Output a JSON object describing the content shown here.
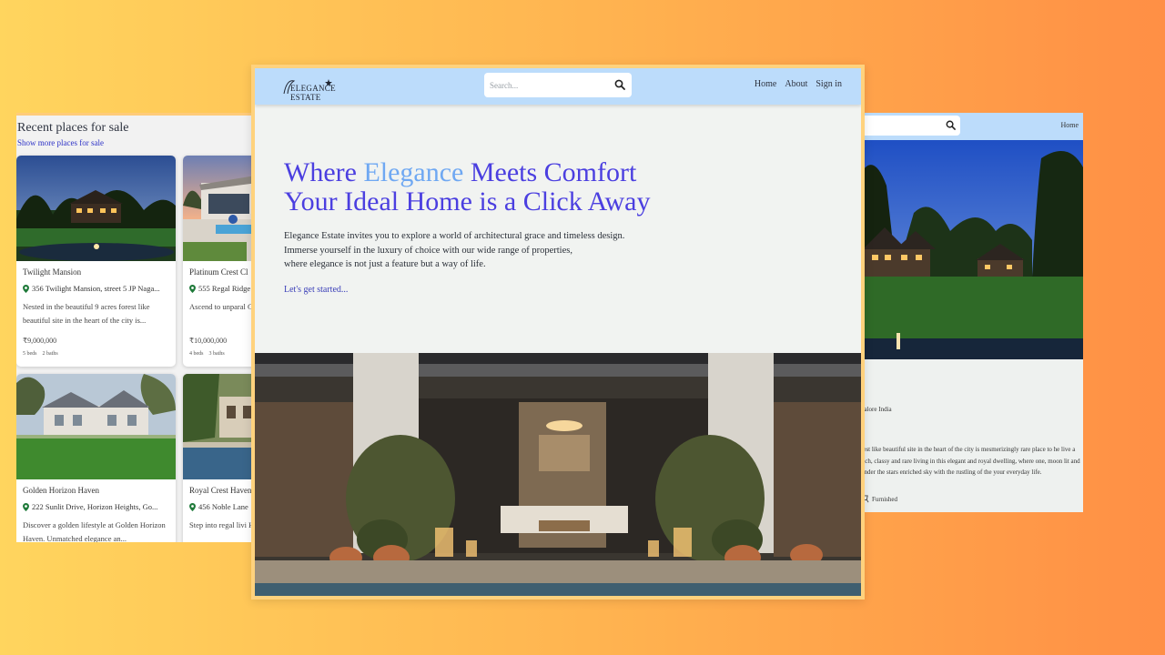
{
  "left_panel": {
    "heading": "Recent places for sale",
    "more_link": "Show more places for sale",
    "cards": [
      {
        "name": "Twilight Mansion",
        "address": "356 Twilight Mansion, street 5 JP Naga...",
        "description": "Nested in the beautiful 9 acres forest like beautiful site in the heart of the city is...",
        "price": "₹9,000,000",
        "beds": "5 beds",
        "baths": "2 baths"
      },
      {
        "name": "Platinum Crest Cl",
        "address": "555 Regal Ridge",
        "description": "Ascend to unparal Crest Chateau. Th",
        "price": "₹10,000,000",
        "beds": "4 beds",
        "baths": "3 baths"
      },
      {
        "name": "Golden Horizon Haven",
        "address": "222 Sunlit Drive, Horizon Heights, Go...",
        "description": "Discover a golden lifestyle at Golden Horizon Haven. Unmatched elegance an..."
      },
      {
        "name": "Royal Crest Haven",
        "address": "456 Noble Lane",
        "description": "Step into regal livi Haven. Majestic ar"
      }
    ]
  },
  "right_panel": {
    "home_link": "Home",
    "location": "galore India",
    "description": "rest like beautiful site in the heart of the city is mesmerizingly rare place to he live a rich, classy and rare living in this elegant and royal dwelling, where one, moon lit and under the stars enriched sky with the rustling of the your everyday life.",
    "furnished": "Furnished"
  },
  "main": {
    "logo_text": "ELEGANCE ESTATE",
    "search_placeholder": "Search...",
    "nav": {
      "home": "Home",
      "about": "About",
      "signin": "Sign in"
    },
    "hero": {
      "line1_pre": "Where ",
      "line1_accent": "Elegance",
      "line1_post": " Meets Comfort",
      "line2": "Your Ideal Home is a Click Away"
    },
    "copy": {
      "line1": "Elegance Estate invites you to explore a world of architectural grace and timeless design.",
      "line2": "Immerse yourself in the luxury of choice with our wide range of properties,",
      "line3": "where elegance is not just a feature but a way of life."
    },
    "cta": "Let's get started..."
  },
  "colors": {
    "navbar": "#bcdcfb",
    "title": "#4b3fe0",
    "title_accent": "#6fa8f2",
    "link": "#2c31c6",
    "pin": "#1f7a3a",
    "background_start": "#ffd55e",
    "background_end": "#ff8f45"
  },
  "icons": [
    "search-icon",
    "location-pin-icon",
    "furniture-icon",
    "logo-star-icon"
  ]
}
